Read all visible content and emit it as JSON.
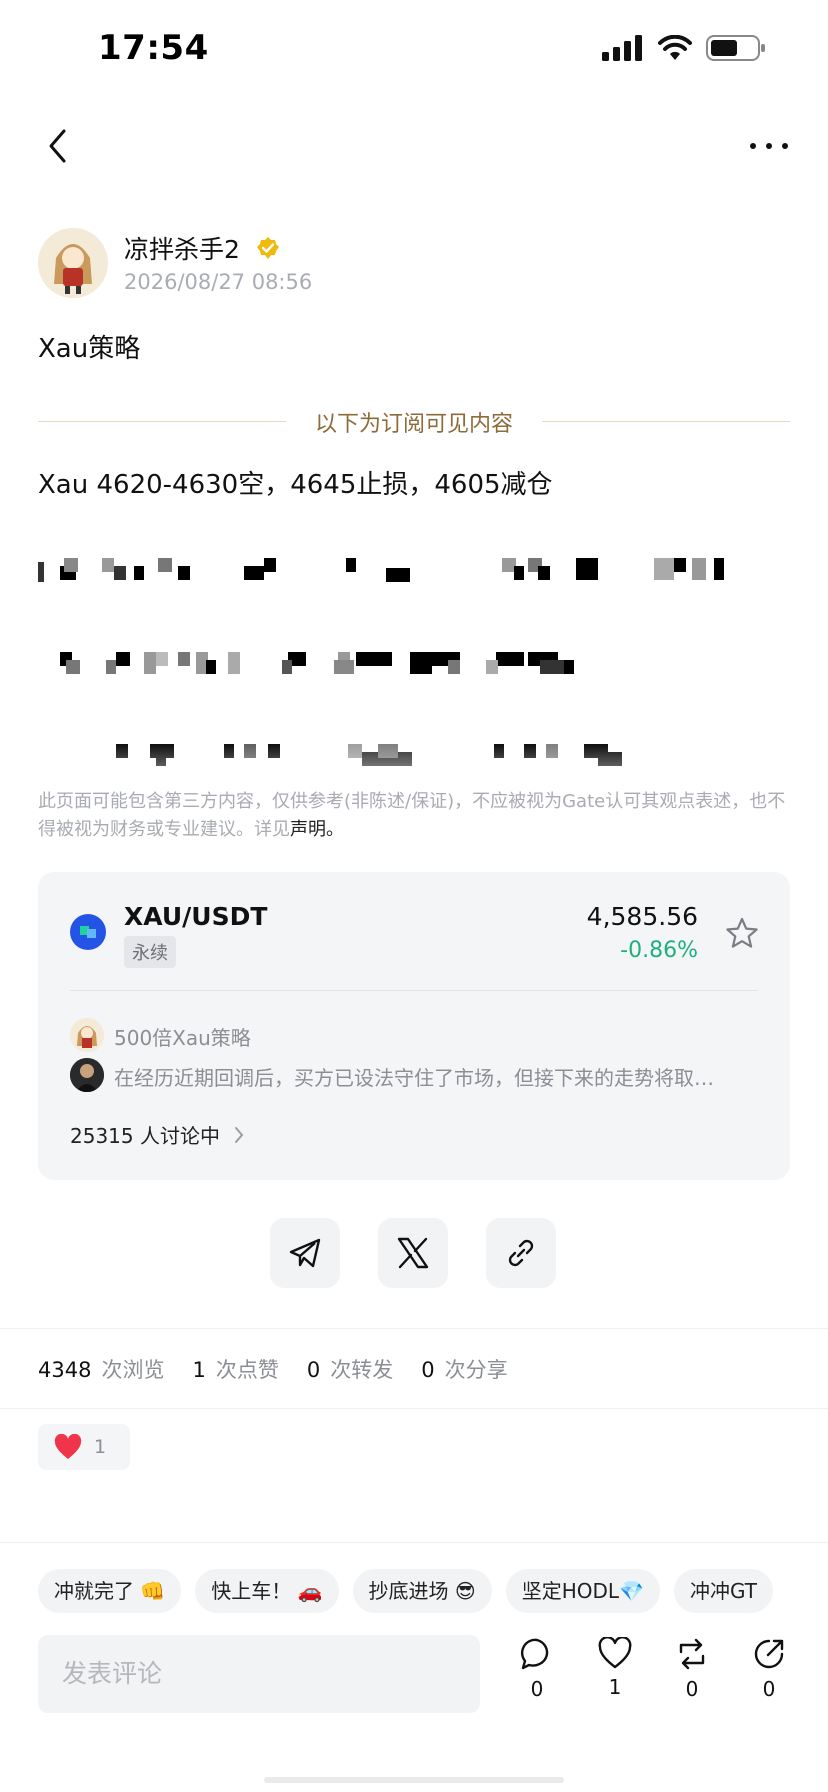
{
  "status_bar": {
    "time": "17:54"
  },
  "author": {
    "name": "凉拌杀手2",
    "post_time": "2026/08/27 08:56"
  },
  "post": {
    "title": "Xau策略",
    "subscriber_divider": "以下为订阅可见内容",
    "content_line": "Xau 4620-4630空，4645止损，4605减仓"
  },
  "disclaimer": {
    "text": "此页面可能包含第三方内容，仅供参考(非陈述/保证)，不应被视为Gate认可其观点表述，也不得被视为财务或专业建议。详见",
    "link": "声明。"
  },
  "market_card": {
    "pair": "XAU/USDT",
    "tag": "永续",
    "price": "4,585.56",
    "change": "-0.86%",
    "change_color": "#1fb07c",
    "feed": [
      {
        "text": "500倍Xau策略"
      },
      {
        "text": "在经历近期回调后，买方已设法守住了市场，但接下来的走势将取…"
      }
    ],
    "discussing": "25315 人讨论中"
  },
  "share": {
    "icons": [
      "telegram-icon",
      "x-icon",
      "link-icon"
    ]
  },
  "stats": {
    "views": "4348",
    "views_label": "次浏览",
    "likes": "1",
    "likes_label": "次点赞",
    "reposts": "0",
    "reposts_label": "次转发",
    "shares": "0",
    "shares_label": "次分享"
  },
  "reaction": {
    "emoji": "heart",
    "count": "1"
  },
  "quick_comments": [
    "冲就完了 👊",
    "快上车！ 🚗",
    "抄底进场 😎",
    "坚定HODL💎",
    "冲冲GT"
  ],
  "comment": {
    "placeholder": "发表评论"
  },
  "actions": {
    "comment": "0",
    "like": "1",
    "repost": "0",
    "share": "0"
  }
}
